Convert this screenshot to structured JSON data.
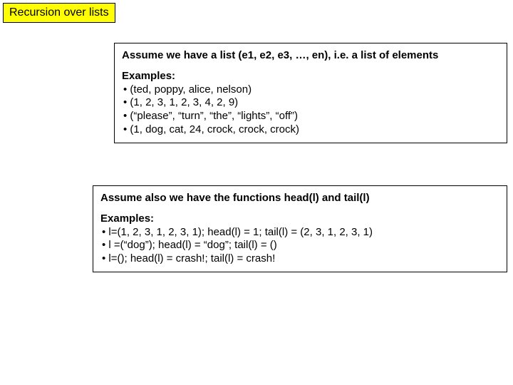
{
  "title": "Recursion over lists",
  "box1": {
    "lead": "Assume we have a list (e1, e2, e3, …, en), i.e. a list of elements",
    "hdr": "Examples:",
    "b1": "• (ted, poppy, alice, nelson)",
    "b2": "• (1, 2, 3, 1, 2, 3, 4, 2, 9)",
    "b3": "• (“please”, “turn”, “the”, “lights”, “off”)",
    "b4": "• (1, dog, cat, 24, crock, crock, crock)"
  },
  "box2": {
    "lead": "Assume also we have the functions head(l) and tail(l)",
    "hdr": "Examples:",
    "b1": "• l=(1, 2, 3, 1, 2, 3, 1); head(l) = 1; tail(l) = (2, 3, 1, 2, 3, 1)",
    "b2": "• l =(“dog”); head(l) = “dog”; tail(l) = ()",
    "b3": "• l=(); head(l) = crash!; tail(l) = crash!"
  }
}
